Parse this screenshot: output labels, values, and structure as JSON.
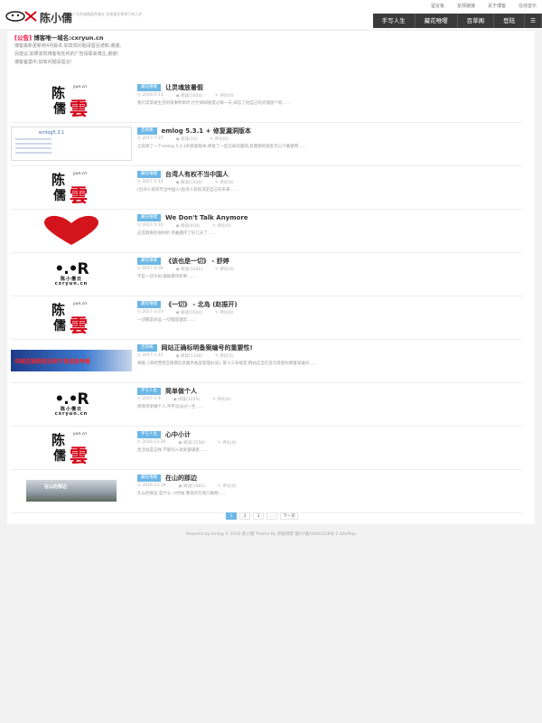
{
  "header": {
    "site_name": "陈小儒",
    "tagline": "人生的道路虽然漫长 但紧要处常常只有几步",
    "top_links": [
      "留言板",
      "友情链接",
      "关于博客",
      "在线音乐"
    ],
    "nav": [
      "手写人生",
      "藏花唯嘤",
      "百草阁",
      "登陆"
    ]
  },
  "notice": {
    "tag": "[公告]",
    "title": "博客唯一域名:cxryun.cn",
    "lines": [
      "博客最新更新到4月版本,如发现问题请留言通知,谢谢。",
      "另建议,如果发现博客有任何的广告请联系博主,谢谢!",
      "博客备案中,如有问题请留言!"
    ]
  },
  "posts": [
    {
      "badge": "藏花唯嘤",
      "title": "让灵魂放暑假",
      "date": "2018-5-13",
      "views": "阅读(1034)",
      "comments": "评论(0)",
      "excerpt": "我们常常被生活的琐事所牵绊,忙忙碌碌地度过每一天,却忘了给自己的灵魂放个假……",
      "art": "calli"
    },
    {
      "badge": "百草阁",
      "title": "emlog 5.3.1 + 修复漏洞版本",
      "date": "2017-7-27",
      "views": "阅读(11)",
      "comments": "评论(0)",
      "excerpt": "之前发了一个emlog 5.3.1的修复版本,修复了一些已知的漏洞,有需要的朋友可以下载使用……",
      "art": "shot"
    },
    {
      "badge": "藏花唯嘤",
      "title": "台湾人有权不当中国人",
      "date": "2017-5-12",
      "views": "阅读(1334)",
      "comments": "评论(0)",
      "excerpt": "[台湾人有权不当中国人]台湾人有权决定自己的未来……",
      "art": "calli"
    },
    {
      "badge": "藏花唯嘤",
      "title": "We Don't Talk Anymore",
      "date": "2017-5-10",
      "views": "阅读(910)",
      "comments": "评论(0)",
      "excerpt": "这首歌真的很好听,单曲循环了好几天了……",
      "art": "heart"
    },
    {
      "badge": "藏花唯嘤",
      "title": "《该也是一切》 - 舒婷",
      "date": "2017-3-30",
      "views": "阅读(1341)",
      "comments": "评论(0)",
      "excerpt": "不是一切大树,都被暴风折断……",
      "art": "logo"
    },
    {
      "badge": "藏花唯嘤",
      "title": "《一切》 - 北岛 (赵振开)",
      "date": "2017-3-23",
      "views": "阅读(1543)",
      "comments": "评论(0)",
      "excerpt": "一切都是命运 一切都是烟云……",
      "art": "calli"
    },
    {
      "badge": "百草阁",
      "title": "网站正确标明备案编号的重要性!",
      "date": "2017-1-12",
      "views": "阅读(1338)",
      "comments": "评论(1)",
      "excerpt": "根据《非经营性互联网信息服务备案管理办法》第十三条规定,网站应当在首页底部标明备案编号……",
      "art": "banner"
    },
    {
      "badge": "手写人生",
      "title": "简单做个人",
      "date": "2017-1-4",
      "views": "阅读(1255)",
      "comments": "评论(0)",
      "excerpt": "简简单单做个人,平平淡淡过一生……",
      "art": "logo"
    },
    {
      "badge": "手写人生",
      "title": "心中小计",
      "date": "2016-12-26",
      "views": "阅读(1158)",
      "comments": "评论(0)",
      "excerpt": "生活总是这样,不能叫人处处都满意……",
      "art": "calli"
    },
    {
      "badge": "藏花唯嘤",
      "title": "在山的那边",
      "date": "2016-12-19",
      "views": "阅读(1561)",
      "comments": "评论(0)",
      "excerpt": "在山的那边 是什么 小时候 我常伏在窗口痴想……",
      "art": "photo"
    }
  ],
  "pager": {
    "pages": [
      "1",
      "2",
      "3",
      "…"
    ],
    "next": "下一页"
  },
  "footer": {
    "text": "Powered by emlog © 2016 陈小儒 Theme By 智能博客 蜀ICP备16003319号-2 SiteMap"
  },
  "logo_art": {
    "l1": "•.•R",
    "l2": "陈小儒云",
    "l3": "cxryun.cn"
  },
  "calli_art": {
    "a": "陈",
    "b": "儒",
    "c": "雲",
    "d": "yun.cn"
  },
  "shot_art": {
    "heading": "emlog5.3.1"
  },
  "banner_art": {
    "text": "中国互联网违法和不良信息举报"
  },
  "photo_art": {
    "caption": "在山的那边"
  },
  "colors": {
    "accent": "#6cb7e6",
    "nav_bg": "#3a3a3a",
    "brand_red": "#d20015"
  }
}
